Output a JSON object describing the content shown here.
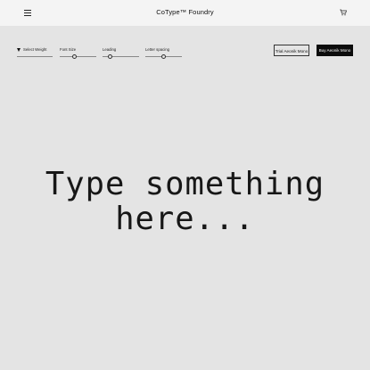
{
  "header": {
    "brand": "CoType™ Foundry",
    "menu_icon": "hamburger-menu-icon",
    "cart_icon": "cart-icon"
  },
  "controls": {
    "weight_label": "Select Weight",
    "font_size_label": "Font Size",
    "leading_label": "Leading",
    "letter_spacing_label": "Letter spacing"
  },
  "actions": {
    "trial_label": "Trial Aeonik Mono",
    "buy_label": "Buy Aeonik Mono"
  },
  "specimen": {
    "line1": "Type something",
    "line2": "here..."
  },
  "colors": {
    "background": "#e4e4e4",
    "header": "#f4f4f4",
    "primary_button": "#0c0c0c"
  }
}
